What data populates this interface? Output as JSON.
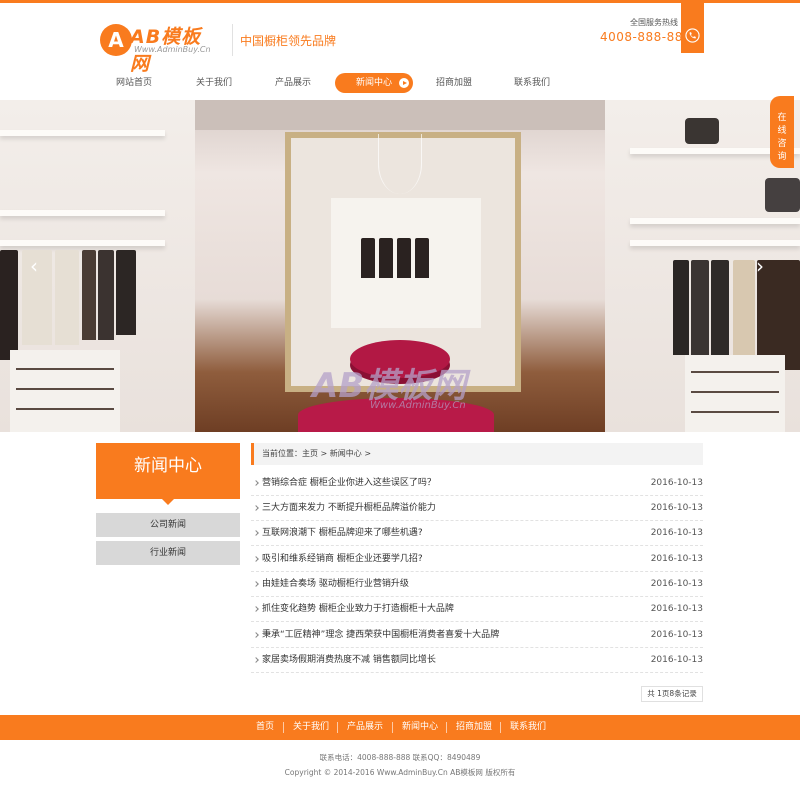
{
  "header": {
    "logo_mark": "A",
    "logo_text": "AB模板网",
    "logo_sub": "Www.AdminBuy.Cn",
    "slogan": "中国橱柜领先品牌",
    "hotline_label": "全国服务热线",
    "hotline_number": "4008-888-888"
  },
  "nav": {
    "items": [
      {
        "label": "网站首页"
      },
      {
        "label": "关于我们"
      },
      {
        "label": "产品展示"
      },
      {
        "label": "新闻中心",
        "active": true
      },
      {
        "label": "招商加盟"
      },
      {
        "label": "联系我们"
      }
    ]
  },
  "banner": {
    "watermark": "AB模板网",
    "watermark_sub": "Www.AdminBuy.Cn",
    "prev_label": "‹",
    "next_label": "›"
  },
  "consult": {
    "label": "在线咨询"
  },
  "sidebar": {
    "title": "新闻中心",
    "items": [
      {
        "label": "公司新闻"
      },
      {
        "label": "行业新闻"
      }
    ]
  },
  "breadcrumb": {
    "text": "当前位置：主页 > 新闻中心 >"
  },
  "news": [
    {
      "title": "营销综合症 橱柜企业你进入这些误区了吗？",
      "date": "2016-10-13"
    },
    {
      "title": "三大方面来发力 不断提升橱柜品牌溢价能力",
      "date": "2016-10-13"
    },
    {
      "title": "互联网浪潮下 橱柜品牌迎来了哪些机遇?",
      "date": "2016-10-13"
    },
    {
      "title": "吸引和维系经销商 橱柜企业还要学几招?",
      "date": "2016-10-13"
    },
    {
      "title": "由娃娃合奏场 驱动橱柜行业营销升级",
      "date": "2016-10-13"
    },
    {
      "title": "抓住变化趋势 橱柜企业致力于打造橱柜十大品牌",
      "date": "2016-10-13"
    },
    {
      "title": "秉承“工匠精神”理念 捷西荣获中国橱柜消费者喜爱十大品牌",
      "date": "2016-10-13"
    },
    {
      "title": "家居卖场假期消费热度不减 销售额同比增长",
      "date": "2016-10-13"
    }
  ],
  "pager": {
    "text": "共 1页8条记录"
  },
  "footer": {
    "links": [
      {
        "label": "首页"
      },
      {
        "label": "关于我们"
      },
      {
        "label": "产品展示"
      },
      {
        "label": "新闻中心"
      },
      {
        "label": "招商加盟"
      },
      {
        "label": "联系我们"
      }
    ],
    "contact": "联系电话：4008-888-888    联系QQ：8490489",
    "copyright": "Copyright © 2014-2016 Www.AdminBuy.Cn AB模板网 版权所有"
  },
  "colors": {
    "accent": "#f97b1e",
    "sidebar_item": "#d8d8d8"
  }
}
